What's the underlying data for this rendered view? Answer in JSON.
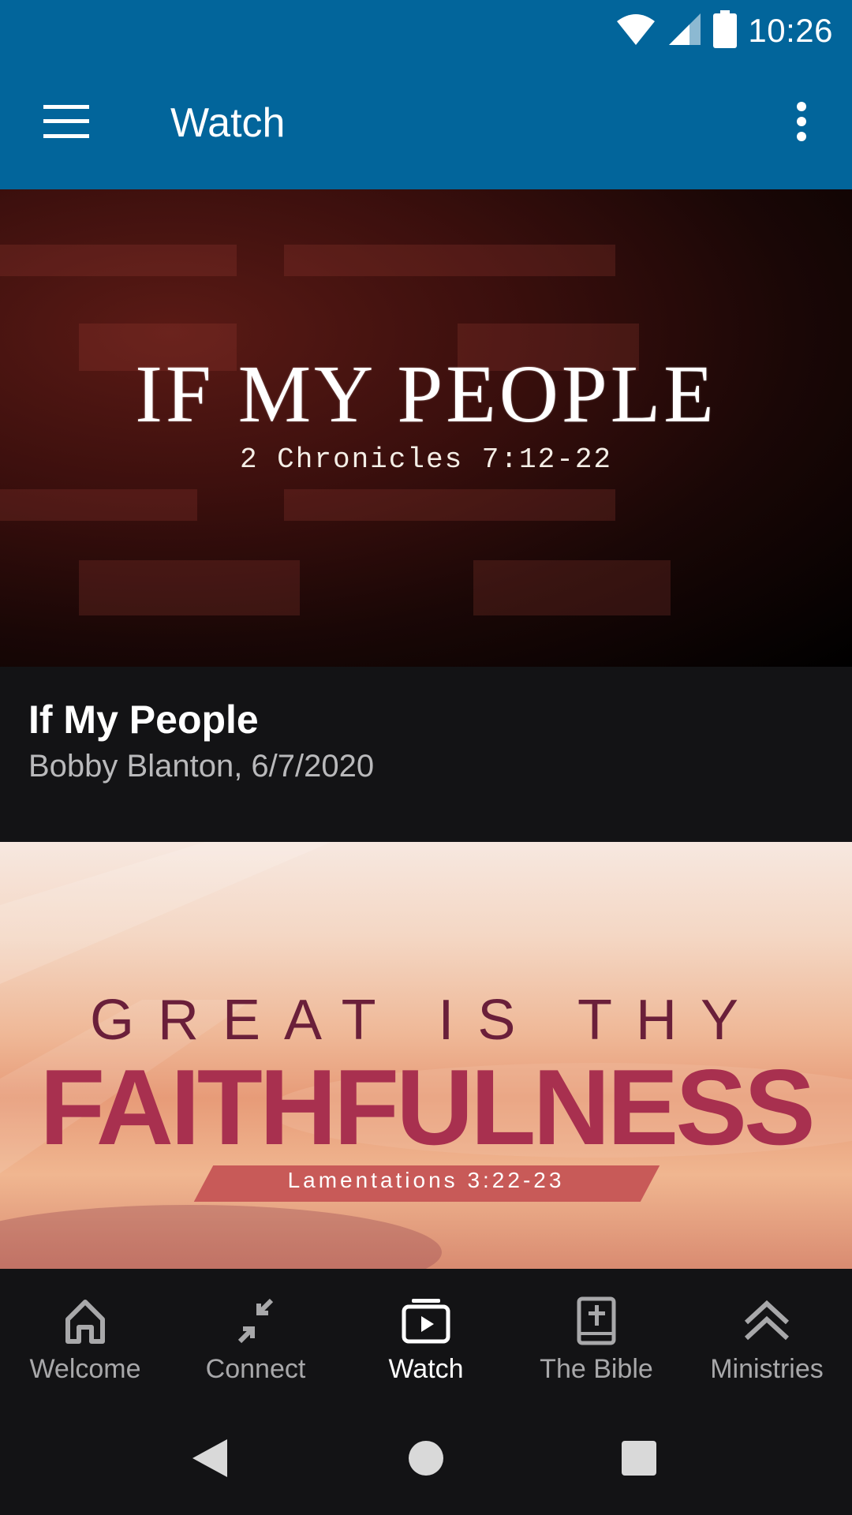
{
  "status_bar": {
    "time": "10:26",
    "icons": [
      "wifi-icon",
      "signal-icon",
      "battery-icon"
    ]
  },
  "app_bar": {
    "title": "Watch",
    "menu_icon": "hamburger-menu-icon",
    "overflow_icon": "more-vert-icon"
  },
  "sermons": [
    {
      "artwork_title": "IF MY PEOPLE",
      "artwork_subtitle": "2 Chronicles 7:12-22",
      "title": "If My People",
      "meta": "Bobby Blanton, 6/7/2020"
    },
    {
      "artwork_line1": "GREAT IS THY",
      "artwork_line2": "FAITHFULNESS",
      "artwork_reference": "Lamentations 3:22-23"
    }
  ],
  "bottom_nav": {
    "items": [
      {
        "label": "Welcome",
        "icon": "home-icon",
        "active": false
      },
      {
        "label": "Connect",
        "icon": "connect-arrows-icon",
        "active": false
      },
      {
        "label": "Watch",
        "icon": "video-library-icon",
        "active": true
      },
      {
        "label": "The Bible",
        "icon": "bible-icon",
        "active": false
      },
      {
        "label": "Ministries",
        "icon": "double-chevron-up-icon",
        "active": false
      }
    ]
  },
  "system_nav": {
    "icons": [
      "back-icon",
      "home-circle-icon",
      "recents-icon"
    ]
  },
  "colors": {
    "app_bar": "#02659B",
    "background": "#131315",
    "active_nav": "#FFFFFF",
    "inactive_nav": "#A8A8AA"
  }
}
